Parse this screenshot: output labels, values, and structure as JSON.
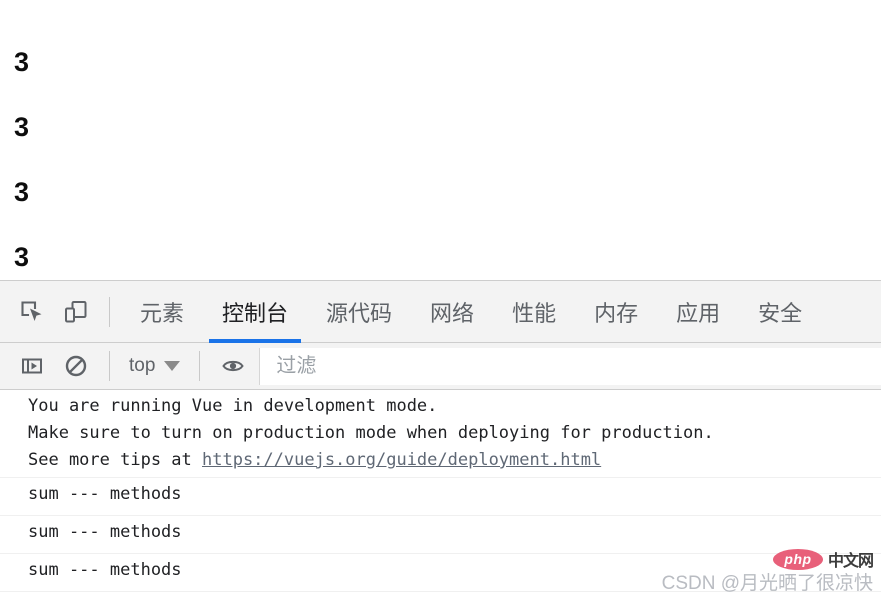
{
  "page": {
    "output_lines": [
      "3",
      "3",
      "3",
      "3"
    ]
  },
  "devtools": {
    "toolbar_icons": {
      "inspect": "inspect-element-icon",
      "device": "device-toolbar-icon"
    },
    "tabs": [
      {
        "label": "元素",
        "name": "elements",
        "active": false
      },
      {
        "label": "控制台",
        "name": "console",
        "active": true
      },
      {
        "label": "源代码",
        "name": "sources",
        "active": false
      },
      {
        "label": "网络",
        "name": "network",
        "active": false
      },
      {
        "label": "性能",
        "name": "performance",
        "active": false
      },
      {
        "label": "内存",
        "name": "memory",
        "active": false
      },
      {
        "label": "应用",
        "name": "application",
        "active": false
      },
      {
        "label": "安全",
        "name": "security",
        "active": false
      }
    ],
    "active_tab": "控制台",
    "accent_color": "#1a73e8",
    "console_toolbar": {
      "sidebar_toggle_icon": "console-sidebar-icon",
      "clear_icon": "clear-console-icon",
      "context_label": "top",
      "eye_icon": "live-expression-eye-icon",
      "filter_placeholder": "过滤",
      "filter_value": ""
    },
    "console_messages": [
      {
        "lines": [
          "You are running Vue in development mode.",
          "Make sure to turn on production mode when deploying for production.",
          "See more tips at "
        ],
        "link": "https://vuejs.org/guide/deployment.html"
      },
      {
        "lines": [
          "sum --- methods"
        ],
        "link": ""
      },
      {
        "lines": [
          "sum --- methods"
        ],
        "link": ""
      },
      {
        "lines": [
          "sum --- methods"
        ],
        "link": ""
      }
    ]
  },
  "watermark": {
    "text": "CSDN @月光晒了很凉快",
    "logo_text": "php",
    "logo_suffix": "中文网",
    "logo_color": "#e8607a"
  }
}
